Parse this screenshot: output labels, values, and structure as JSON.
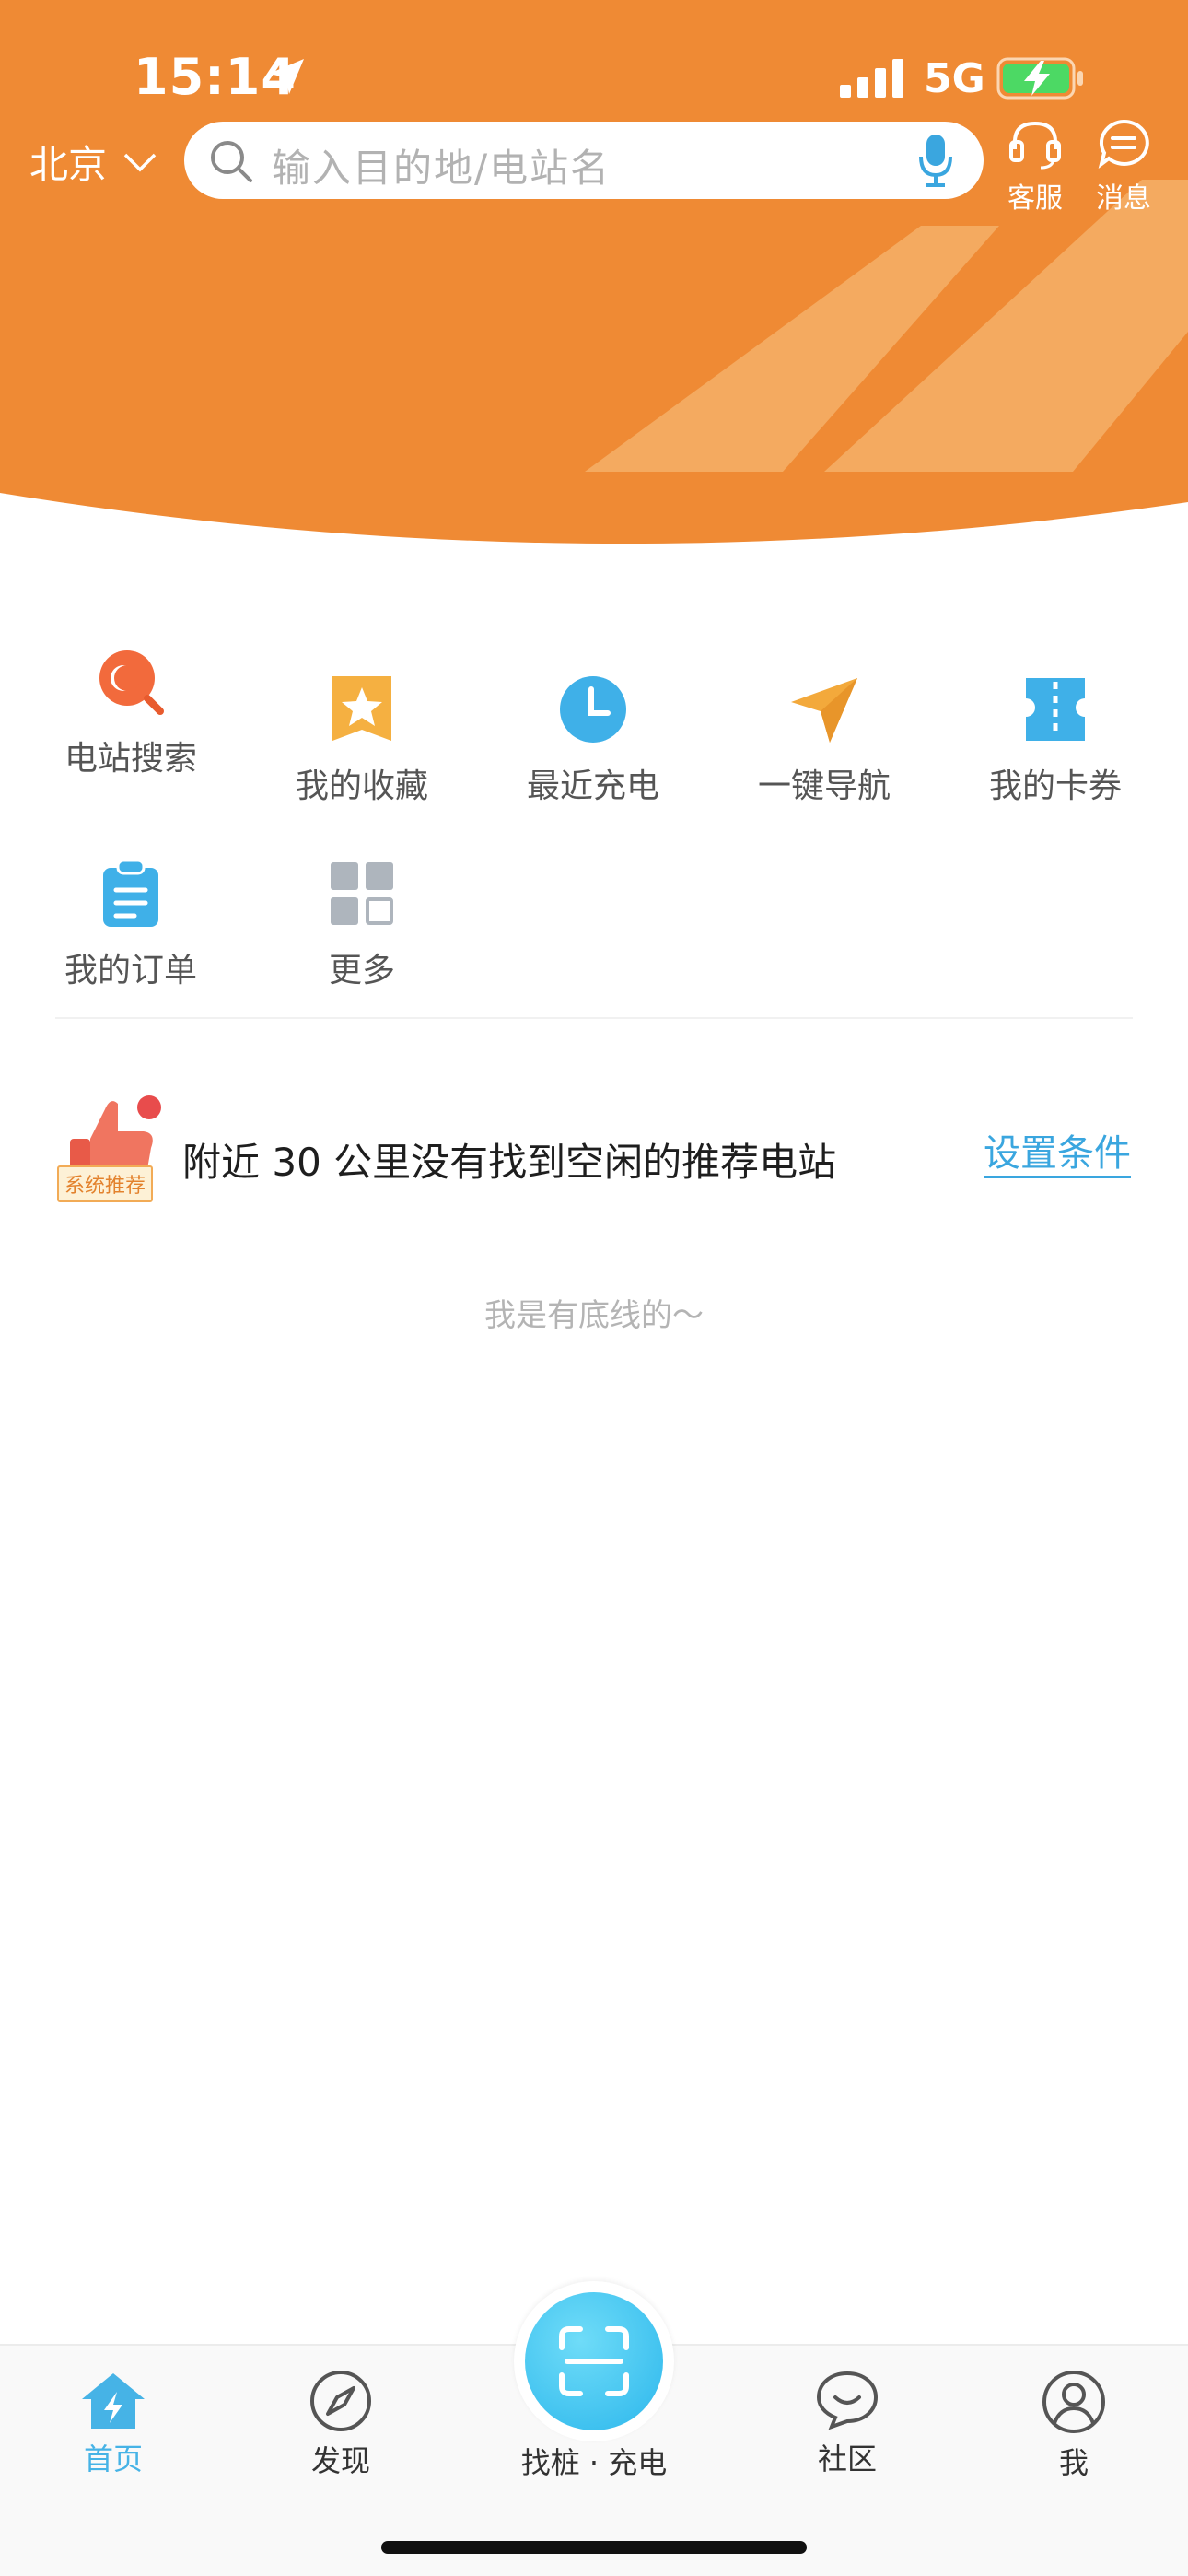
{
  "status_bar": {
    "time": "15:14",
    "network": "5G"
  },
  "header": {
    "city": "北京",
    "search_placeholder": "输入目的地/电站名",
    "service_label": "客服",
    "message_label": "消息"
  },
  "menu": [
    {
      "label": "电站搜索",
      "icon": "station-search-icon"
    },
    {
      "label": "我的收藏",
      "icon": "favorites-star-icon"
    },
    {
      "label": "最近充电",
      "icon": "clock-icon"
    },
    {
      "label": "一键导航",
      "icon": "navigation-arrow-icon"
    },
    {
      "label": "我的卡券",
      "icon": "coupon-icon"
    },
    {
      "label": "我的订单",
      "icon": "order-clipboard-icon"
    },
    {
      "label": "更多",
      "icon": "grid-more-icon"
    }
  ],
  "recommendation": {
    "badge": "系统推荐",
    "text": "附近 30 公里没有找到空闲的推荐电站",
    "link": "设置条件"
  },
  "bottom_line": "我是有底线的～",
  "tabbar": {
    "home": "首页",
    "discover": "发现",
    "scan": "找桩 · 充电",
    "community": "社区",
    "me": "我"
  },
  "colors": {
    "brand_orange": "#ef8a34",
    "accent_blue": "#46b3e6",
    "text_dark": "#1e1e1e"
  }
}
